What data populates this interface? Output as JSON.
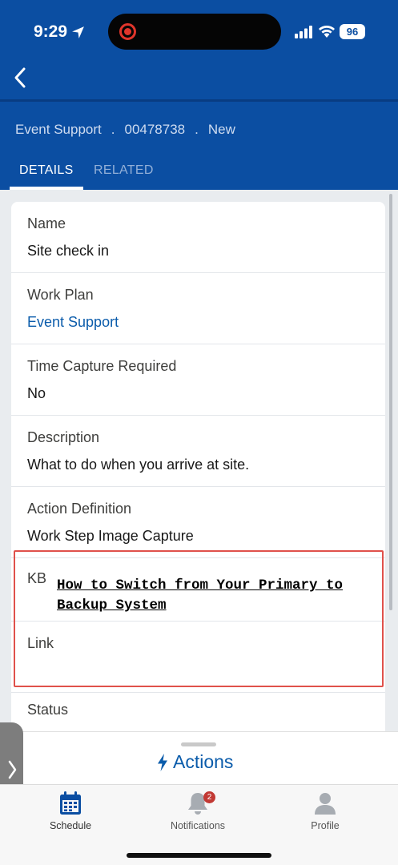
{
  "status_bar": {
    "time": "9:29",
    "battery": "96"
  },
  "breadcrumb": {
    "object": "Event Support",
    "separator": ".",
    "record_number": "00478738",
    "status": "New"
  },
  "tabs": [
    {
      "label": "DETAILS",
      "active": true
    },
    {
      "label": "RELATED",
      "active": false
    }
  ],
  "fields": [
    {
      "label": "Name",
      "value": "Site check in"
    },
    {
      "label": "Work Plan",
      "value": "Event Support"
    },
    {
      "label": "Time Capture Required",
      "value": "No"
    },
    {
      "label": "Description",
      "value": "What to do when you arrive at site."
    },
    {
      "label": "Action Definition",
      "value": "Work Step Image Capture"
    },
    {
      "label": "KB",
      "value": "How to Switch from Your Primary to Backup System"
    },
    {
      "label": "Link",
      "value": ""
    },
    {
      "label": "Status",
      "value": ""
    }
  ],
  "actions": {
    "label": "Actions"
  },
  "bottom_nav": [
    {
      "label": "Schedule",
      "icon": "calendar-icon"
    },
    {
      "label": "Notifications",
      "icon": "bell-icon",
      "badge": "2"
    },
    {
      "label": "Profile",
      "icon": "person-icon"
    }
  ],
  "colors": {
    "header": "#0b4ea2",
    "link": "#0b5cab",
    "highlight": "#e0514b",
    "badge": "#c23934"
  }
}
